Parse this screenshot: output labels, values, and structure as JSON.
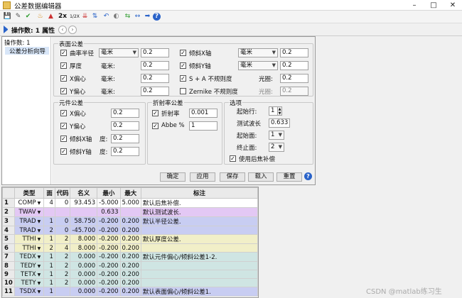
{
  "window": {
    "title": "公差数据编辑器",
    "minimize_glyph": "–",
    "maximize_glyph": "□",
    "close_glyph": "✕"
  },
  "toolbar": {
    "items": [
      {
        "icon": "save-icon",
        "glyph": "💾"
      },
      {
        "icon": "edit-icon",
        "glyph": "✎"
      },
      {
        "icon": "check-icon",
        "glyph": "✔"
      },
      {
        "icon": "wizard-icon",
        "glyph": "♨"
      },
      {
        "icon": "chart-icon",
        "glyph": "▲"
      },
      {
        "icon": "double-icon",
        "text": "2x"
      },
      {
        "icon": "half-icon",
        "text": "1/2X"
      },
      {
        "icon": "sort-down-icon",
        "glyph": "⇊"
      },
      {
        "icon": "sort-up-icon",
        "glyph": "⇅"
      },
      {
        "icon": "undo-icon",
        "glyph": "↶"
      },
      {
        "icon": "toggle-icon",
        "glyph": "◐"
      },
      {
        "icon": "swap-icon",
        "glyph": "⇆"
      },
      {
        "icon": "expand-icon",
        "glyph": "↔"
      },
      {
        "icon": "forward-icon",
        "glyph": "➡"
      },
      {
        "icon": "help-icon",
        "glyph": "?"
      }
    ]
  },
  "opsbar": {
    "label": "操作数: 1 属性",
    "prev": "‹",
    "next": "›"
  },
  "left_panel": {
    "header": "操作数: 1",
    "item": "公差分析向导"
  },
  "surface_group": {
    "title": "表面公差",
    "radius": {
      "label": "曲率半径",
      "checked": true,
      "unit": "毫米",
      "value": "0.2"
    },
    "thickness": {
      "label": "厚度",
      "checked": true,
      "unit": "毫米:",
      "value": "0.2"
    },
    "xdecenter": {
      "label": "X偏心",
      "checked": true,
      "unit": "毫米:",
      "value": "0.2"
    },
    "ydecenter": {
      "label": "Y偏心",
      "checked": true,
      "unit": "毫米:",
      "value": "0.2"
    },
    "xtilt": {
      "label": "倾斜X轴",
      "checked": true,
      "unit": "毫米",
      "value": "0.2"
    },
    "ytilt": {
      "label": "倾斜Y轴",
      "checked": true,
      "unit": "毫米",
      "value": "0.2"
    },
    "sa": {
      "label": "S + A 不规则度",
      "checked": true,
      "sublabel": "光圈:",
      "value": "0.2"
    },
    "zernike": {
      "label": "Zernike 不规则度",
      "checked": false,
      "sublabel": "光圈:",
      "value": "0.2"
    }
  },
  "element_group": {
    "title": "元件公差",
    "rows": [
      {
        "label": "X偏心",
        "unit": "",
        "value": "0.2",
        "checked": true
      },
      {
        "label": "Y偏心",
        "unit": "",
        "value": "0.2",
        "checked": true
      },
      {
        "label": "倾斜X轴",
        "unit": "度:",
        "value": "0.2",
        "checked": true
      },
      {
        "label": "倾斜Y轴",
        "unit": "度:",
        "value": "0.2",
        "checked": true
      }
    ]
  },
  "index_group": {
    "title": "折射率公差",
    "index": {
      "label": "折射率",
      "value": "0.001",
      "checked": true
    },
    "abbe": {
      "label": "Abbe %",
      "value": "1",
      "checked": true
    }
  },
  "options_group": {
    "title": "选项",
    "start_row": {
      "label": "起始行:",
      "value": "1"
    },
    "test_wavelength": {
      "label": "测试波长",
      "value": "0.633"
    },
    "start_surface": {
      "label": "起始面:",
      "value": "1"
    },
    "stop_surface": {
      "label": "终止面:",
      "value": "2"
    },
    "use_comp": {
      "label": "使用后焦补偿",
      "checked": true
    }
  },
  "buttons": {
    "ok": "确定",
    "apply": "应用",
    "save": "保存",
    "load": "载入",
    "reset": "重置",
    "help": "?"
  },
  "grid": {
    "headers": [
      "",
      "类型",
      "面",
      "代码",
      "名义",
      "最小",
      "最大",
      "标注"
    ],
    "rows": [
      {
        "n": "1",
        "type": "COMP",
        "dd": true,
        "surf": "4",
        "code": "0",
        "nom": "93.453",
        "min": "-5.000",
        "max": "5.000",
        "note": "默认后焦补偿.",
        "color": "#ffffff"
      },
      {
        "n": "2",
        "type": "TWAV",
        "dd": true,
        "surf": "",
        "code": "",
        "nom": "",
        "min": "0.633",
        "max": "",
        "note": "默认测试波长.",
        "color": "#e3c8f4"
      },
      {
        "n": "3",
        "type": "TRAD",
        "dd": true,
        "surf": "1",
        "code": "0",
        "nom": "58.750",
        "min": "-0.200",
        "max": "0.200",
        "note": "默认半径公差.",
        "color": "#c8cdf2"
      },
      {
        "n": "4",
        "type": "TRAD",
        "dd": true,
        "surf": "2",
        "code": "0",
        "nom": "-45.700",
        "min": "-0.200",
        "max": "0.200",
        "note": "",
        "color": "#c8cdf2"
      },
      {
        "n": "5",
        "type": "TTHI",
        "dd": true,
        "surf": "1",
        "code": "2",
        "nom": "8.000",
        "min": "-0.200",
        "max": "0.200",
        "note": "默认厚度公差.",
        "color": "#f1efc8"
      },
      {
        "n": "6",
        "type": "TTHI",
        "dd": true,
        "surf": "2",
        "code": "4",
        "nom": "8.000",
        "min": "-0.200",
        "max": "0.200",
        "note": "",
        "color": "#f1efc8"
      },
      {
        "n": "7",
        "type": "TEDX",
        "dd": true,
        "surf": "1",
        "code": "2",
        "nom": "0.000",
        "min": "-0.200",
        "max": "0.200",
        "note": "默认元件偏心/倾斜公差1-2.",
        "color": "#cfe5e3"
      },
      {
        "n": "8",
        "type": "TEDY",
        "dd": true,
        "surf": "1",
        "code": "2",
        "nom": "0.000",
        "min": "-0.200",
        "max": "0.200",
        "note": "",
        "color": "#cfe5e3"
      },
      {
        "n": "9",
        "type": "TETX",
        "dd": true,
        "surf": "1",
        "code": "2",
        "nom": "0.000",
        "min": "-0.200",
        "max": "0.200",
        "note": "",
        "color": "#cfe5e3"
      },
      {
        "n": "10",
        "type": "TETY",
        "dd": true,
        "surf": "1",
        "code": "2",
        "nom": "0.000",
        "min": "-0.200",
        "max": "0.200",
        "note": "",
        "color": "#cfe5e3"
      },
      {
        "n": "11",
        "type": "TSDX",
        "dd": true,
        "surf": "1",
        "code": "",
        "nom": "0.000",
        "min": "-0.200",
        "max": "0.200",
        "note": "默认表面偏心/倾斜公差1.",
        "color": "#c8cdf2"
      }
    ]
  },
  "watermark": "CSDN @matlab练习生",
  "colors": {
    "accent": "#2a63c9",
    "selected": "#d8e6f8"
  }
}
